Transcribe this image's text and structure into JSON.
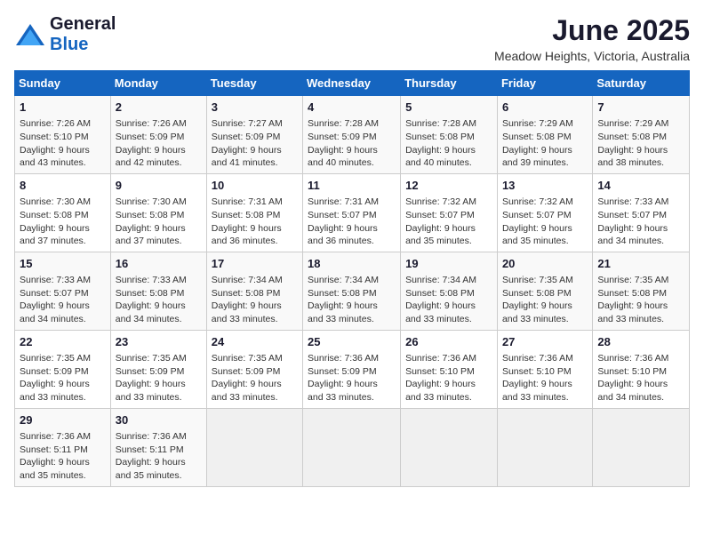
{
  "logo": {
    "general": "General",
    "blue": "Blue"
  },
  "title": "June 2025",
  "location": "Meadow Heights, Victoria, Australia",
  "weekdays": [
    "Sunday",
    "Monday",
    "Tuesday",
    "Wednesday",
    "Thursday",
    "Friday",
    "Saturday"
  ],
  "weeks": [
    [
      {
        "day": "1",
        "info": "Sunrise: 7:26 AM\nSunset: 5:10 PM\nDaylight: 9 hours\nand 43 minutes."
      },
      {
        "day": "2",
        "info": "Sunrise: 7:26 AM\nSunset: 5:09 PM\nDaylight: 9 hours\nand 42 minutes."
      },
      {
        "day": "3",
        "info": "Sunrise: 7:27 AM\nSunset: 5:09 PM\nDaylight: 9 hours\nand 41 minutes."
      },
      {
        "day": "4",
        "info": "Sunrise: 7:28 AM\nSunset: 5:09 PM\nDaylight: 9 hours\nand 40 minutes."
      },
      {
        "day": "5",
        "info": "Sunrise: 7:28 AM\nSunset: 5:08 PM\nDaylight: 9 hours\nand 40 minutes."
      },
      {
        "day": "6",
        "info": "Sunrise: 7:29 AM\nSunset: 5:08 PM\nDaylight: 9 hours\nand 39 minutes."
      },
      {
        "day": "7",
        "info": "Sunrise: 7:29 AM\nSunset: 5:08 PM\nDaylight: 9 hours\nand 38 minutes."
      }
    ],
    [
      {
        "day": "8",
        "info": "Sunrise: 7:30 AM\nSunset: 5:08 PM\nDaylight: 9 hours\nand 37 minutes."
      },
      {
        "day": "9",
        "info": "Sunrise: 7:30 AM\nSunset: 5:08 PM\nDaylight: 9 hours\nand 37 minutes."
      },
      {
        "day": "10",
        "info": "Sunrise: 7:31 AM\nSunset: 5:08 PM\nDaylight: 9 hours\nand 36 minutes."
      },
      {
        "day": "11",
        "info": "Sunrise: 7:31 AM\nSunset: 5:07 PM\nDaylight: 9 hours\nand 36 minutes."
      },
      {
        "day": "12",
        "info": "Sunrise: 7:32 AM\nSunset: 5:07 PM\nDaylight: 9 hours\nand 35 minutes."
      },
      {
        "day": "13",
        "info": "Sunrise: 7:32 AM\nSunset: 5:07 PM\nDaylight: 9 hours\nand 35 minutes."
      },
      {
        "day": "14",
        "info": "Sunrise: 7:33 AM\nSunset: 5:07 PM\nDaylight: 9 hours\nand 34 minutes."
      }
    ],
    [
      {
        "day": "15",
        "info": "Sunrise: 7:33 AM\nSunset: 5:07 PM\nDaylight: 9 hours\nand 34 minutes."
      },
      {
        "day": "16",
        "info": "Sunrise: 7:33 AM\nSunset: 5:08 PM\nDaylight: 9 hours\nand 34 minutes."
      },
      {
        "day": "17",
        "info": "Sunrise: 7:34 AM\nSunset: 5:08 PM\nDaylight: 9 hours\nand 33 minutes."
      },
      {
        "day": "18",
        "info": "Sunrise: 7:34 AM\nSunset: 5:08 PM\nDaylight: 9 hours\nand 33 minutes."
      },
      {
        "day": "19",
        "info": "Sunrise: 7:34 AM\nSunset: 5:08 PM\nDaylight: 9 hours\nand 33 minutes."
      },
      {
        "day": "20",
        "info": "Sunrise: 7:35 AM\nSunset: 5:08 PM\nDaylight: 9 hours\nand 33 minutes."
      },
      {
        "day": "21",
        "info": "Sunrise: 7:35 AM\nSunset: 5:08 PM\nDaylight: 9 hours\nand 33 minutes."
      }
    ],
    [
      {
        "day": "22",
        "info": "Sunrise: 7:35 AM\nSunset: 5:09 PM\nDaylight: 9 hours\nand 33 minutes."
      },
      {
        "day": "23",
        "info": "Sunrise: 7:35 AM\nSunset: 5:09 PM\nDaylight: 9 hours\nand 33 minutes."
      },
      {
        "day": "24",
        "info": "Sunrise: 7:35 AM\nSunset: 5:09 PM\nDaylight: 9 hours\nand 33 minutes."
      },
      {
        "day": "25",
        "info": "Sunrise: 7:36 AM\nSunset: 5:09 PM\nDaylight: 9 hours\nand 33 minutes."
      },
      {
        "day": "26",
        "info": "Sunrise: 7:36 AM\nSunset: 5:10 PM\nDaylight: 9 hours\nand 33 minutes."
      },
      {
        "day": "27",
        "info": "Sunrise: 7:36 AM\nSunset: 5:10 PM\nDaylight: 9 hours\nand 33 minutes."
      },
      {
        "day": "28",
        "info": "Sunrise: 7:36 AM\nSunset: 5:10 PM\nDaylight: 9 hours\nand 34 minutes."
      }
    ],
    [
      {
        "day": "29",
        "info": "Sunrise: 7:36 AM\nSunset: 5:11 PM\nDaylight: 9 hours\nand 35 minutes."
      },
      {
        "day": "30",
        "info": "Sunrise: 7:36 AM\nSunset: 5:11 PM\nDaylight: 9 hours\nand 35 minutes."
      },
      {
        "day": "",
        "info": ""
      },
      {
        "day": "",
        "info": ""
      },
      {
        "day": "",
        "info": ""
      },
      {
        "day": "",
        "info": ""
      },
      {
        "day": "",
        "info": ""
      }
    ]
  ]
}
